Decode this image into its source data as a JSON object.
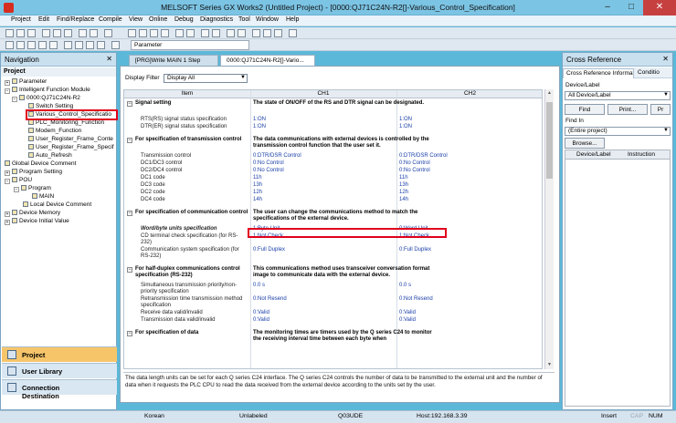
{
  "window": {
    "title": "MELSOFT Series GX Works2 (Untitled Project) - [0000:QJ71C24N-R2[]-Various_Control_Specification]",
    "min": "–",
    "max": "□",
    "close": "✕"
  },
  "menu": [
    "Project",
    "Edit",
    "Find/Replace",
    "Compile",
    "View",
    "Online",
    "Debug",
    "Diagnostics",
    "Tool",
    "Window",
    "Help"
  ],
  "toolbar": {
    "parameter_combo": "Parameter"
  },
  "navigation": {
    "title": "Navigation",
    "section": "Project",
    "tree": [
      {
        "label": "Parameter",
        "icon": "folder-icon"
      },
      {
        "label": "Intelligent Function Module",
        "icon": "folder-icon"
      },
      {
        "label": "0000:QJ71C24N-R2",
        "icon": "module-icon"
      },
      {
        "label": "Switch Setting",
        "icon": "settings-icon"
      },
      {
        "label": "Various_Control_Specificatio",
        "icon": "settings-icon"
      },
      {
        "label": "PLC_Monitoring_Function",
        "icon": "settings-icon"
      },
      {
        "label": "Modem_Function",
        "icon": "settings-icon"
      },
      {
        "label": "User_Register_Frame_Conte",
        "icon": "settings-icon"
      },
      {
        "label": "User_Register_Frame_Specif",
        "icon": "settings-icon"
      },
      {
        "label": "Auto_Refresh",
        "icon": "settings-icon"
      },
      {
        "label": "Global Device Comment",
        "icon": "comment-icon"
      },
      {
        "label": "Program Setting",
        "icon": "folder-icon"
      },
      {
        "label": "POU",
        "icon": "folder-icon"
      },
      {
        "label": "Program",
        "icon": "folder-icon"
      },
      {
        "label": "MAIN",
        "icon": "program-icon"
      },
      {
        "label": "Local Device Comment",
        "icon": "comment-icon"
      },
      {
        "label": "Device Memory",
        "icon": "folder-icon"
      },
      {
        "label": "Device Initial Value",
        "icon": "folder-icon"
      }
    ],
    "buttons": [
      "Project",
      "User Library",
      "Connection Destination"
    ]
  },
  "tabs": [
    {
      "label": "[PRG]Write MAIN 1 Step"
    },
    {
      "label": "0000:QJ71C24N-R2[]-Vario..."
    }
  ],
  "editor": {
    "filter_label": "Display Filter",
    "filter_value": "Display All",
    "columns": [
      "Item",
      "CH1",
      "CH2"
    ],
    "rows": [
      {
        "kind": "section",
        "item": "Signal setting",
        "desc": "The state of ON/OFF of the RS and DTR signal can be designated."
      },
      {
        "kind": "item",
        "item": "RTS(RS) signal status specification",
        "ch1": "1:ON",
        "ch2": "1:ON"
      },
      {
        "kind": "item",
        "item": "DTR(ER) signal status specification",
        "ch1": "1:ON",
        "ch2": "1:ON"
      },
      {
        "kind": "section",
        "item": "For specification of transmission control",
        "desc": "The data communications with external devices is controlled by the transmission control function that the user set it."
      },
      {
        "kind": "item",
        "item": "Transmission control",
        "ch1": "0:DTR/DSR Control",
        "ch2": "0:DTR/DSR Control"
      },
      {
        "kind": "item",
        "item": "DC1/DC3 control",
        "ch1": "0:No Control",
        "ch2": "0:No Control"
      },
      {
        "kind": "item",
        "item": "DC2/DC4 control",
        "ch1": "0:No Control",
        "ch2": "0:No Control"
      },
      {
        "kind": "item",
        "item": "DC1 code",
        "ch1": "11h",
        "ch2": "11h"
      },
      {
        "kind": "item",
        "item": "DC3 code",
        "ch1": "13h",
        "ch2": "13h"
      },
      {
        "kind": "item",
        "item": "DC2 code",
        "ch1": "12h",
        "ch2": "12h"
      },
      {
        "kind": "item",
        "item": "DC4 code",
        "ch1": "14h",
        "ch2": "14h"
      },
      {
        "kind": "section",
        "item": "For specification of communication control",
        "desc": "The user can change the communications method to match the specifications of the external device."
      },
      {
        "kind": "item-highlight",
        "item": "Word/byte units specification",
        "ch1": "1:Byte Unit",
        "ch2": "0:Word Unit"
      },
      {
        "kind": "item",
        "item": "CD terminal check specification (for RS-232)",
        "ch1": "1:Not Check",
        "ch2": "1:Not Check"
      },
      {
        "kind": "item",
        "item": "Communication system specification (for RS-232)",
        "ch1": "0:Full Duplex",
        "ch2": "0:Full Duplex"
      },
      {
        "kind": "section",
        "item": "For half-duplex communications control specification (RS-232)",
        "desc": "This communications method uses transceiver conversation format image to communicate data with the external device."
      },
      {
        "kind": "item",
        "item": "Simultaneous transmission priority/non-priority specification",
        "ch1": "0.0 s",
        "ch2": "0.0 s"
      },
      {
        "kind": "item",
        "item": "Retransmission time transmission method specification",
        "ch1": "0:Not Resend",
        "ch2": "0:Not Resend"
      },
      {
        "kind": "item",
        "item": "Receive data valid/invalid",
        "ch1": "0:Valid",
        "ch2": "0:Valid"
      },
      {
        "kind": "item",
        "item": "Transmission data valid/invalid",
        "ch1": "0:Valid",
        "ch2": "0:Valid"
      },
      {
        "kind": "section",
        "item": "For specification of data",
        "desc": "The monitoring times are timers used by the Q series C24 to monitor the receiving interval time between each byte when"
      }
    ],
    "description": "The data length units can be set for each Q series C24 interface. The Q series C24 controls the number of data to be transmitted to the external unit and the number of data when it requests the PLC CPU to read the data received from the external device according to the units set by the user."
  },
  "xref": {
    "title": "Cross Reference",
    "tabs": [
      "Cross Reference Information",
      "Conditio"
    ],
    "device_label": "Device/Label",
    "device_value": "All Device/Label",
    "find_btn": "Find",
    "print_btn": "Print...",
    "print2_btn": "Pr",
    "find_in_label": "Find In",
    "find_in_value": "(Entire project)",
    "browse_btn": "Browse...",
    "columns": [
      "Device/Label",
      "Instruction"
    ]
  },
  "status": {
    "language": "Korean",
    "label": "Unlabeled",
    "cpu": "Q03UDE",
    "host": "Host:192.168.3.39",
    "mode": "Insert",
    "cap": "CAP",
    "num": "NUM"
  }
}
